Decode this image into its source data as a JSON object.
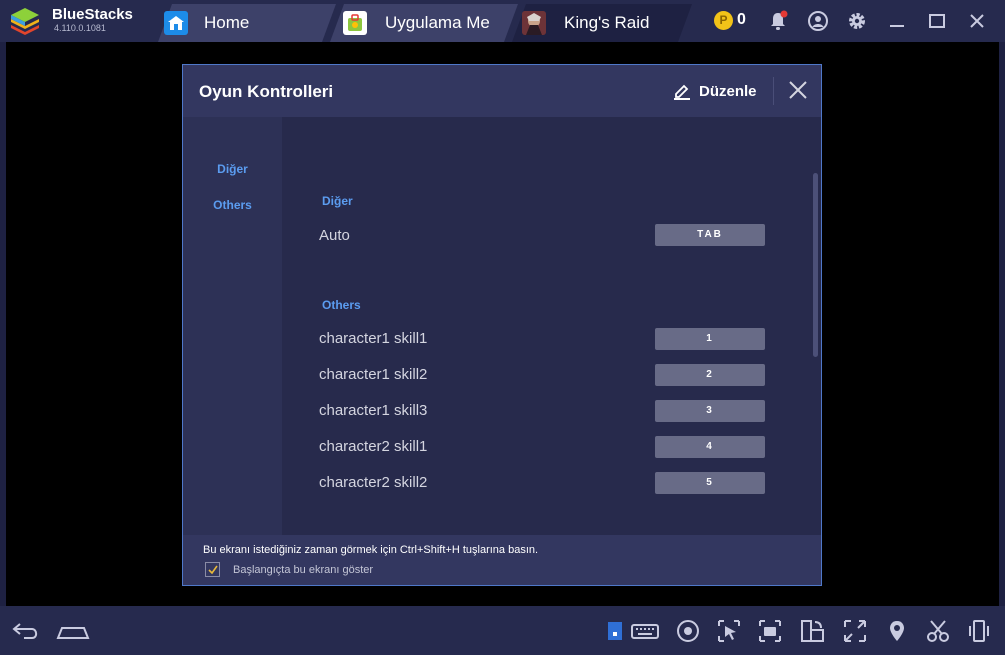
{
  "titlebar": {
    "brand": "BlueStacks",
    "version": "4.110.0.1081",
    "tabs": [
      {
        "label": "Home",
        "icon": "home-icon"
      },
      {
        "label": "Uygulama Me",
        "icon": "app-center-icon"
      },
      {
        "label": "King's Raid",
        "icon": "kings-raid-game-icon"
      }
    ],
    "coin_count": "0",
    "coin_symbol": "P",
    "icons": [
      "coin-icon",
      "notification-bell-icon",
      "account-icon",
      "settings-gear-icon",
      "minimize-icon",
      "maximize-icon",
      "close-icon"
    ]
  },
  "dialog": {
    "title": "Oyun Kontrolleri",
    "edit_label": "Düzenle",
    "sidebar": [
      {
        "label": "Diğer"
      },
      {
        "label": "Others"
      }
    ],
    "sections": [
      {
        "heading": "Diğer",
        "rows": [
          {
            "label": "Auto",
            "key": "TAB"
          }
        ]
      },
      {
        "heading": "Others",
        "rows": [
          {
            "label": "character1 skill1",
            "key": "1"
          },
          {
            "label": "character1 skill2",
            "key": "2"
          },
          {
            "label": "character1 skill3",
            "key": "3"
          },
          {
            "label": "character2 skill1",
            "key": "4"
          },
          {
            "label": "character2 skill2",
            "key": "5"
          }
        ]
      }
    ],
    "footer_text": "Bu ekranı istediğiniz zaman görmek için Ctrl+Shift+H tuşlarına basın.",
    "checkbox_label": "Başlangıçta bu ekranı göster",
    "checkbox_checked": true
  },
  "bottombar": {
    "icons": [
      "back-icon",
      "home-icon",
      "keyboard-mode-icon",
      "keymapping-icon",
      "eye-view-icon",
      "pointer-icon",
      "screenshot-camera-icon",
      "rotate-icon",
      "fullscreen-icon",
      "location-icon",
      "scissors-icon",
      "shake-device-icon"
    ]
  },
  "colors": {
    "accent": "#5b9cf0",
    "dialog_bg": "#2a2d52",
    "key_bg": "#686b87",
    "coin": "#f2c318",
    "notification_dot": "#e53935"
  }
}
